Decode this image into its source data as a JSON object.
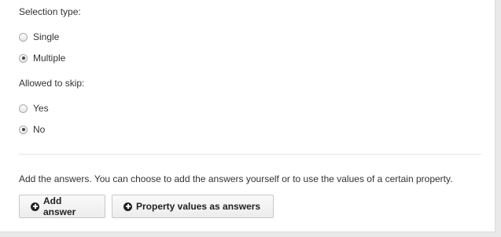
{
  "selection_type": {
    "label": "Selection type:",
    "options": [
      {
        "label": "Single",
        "checked": false
      },
      {
        "label": "Multiple",
        "checked": true
      }
    ]
  },
  "allowed_to_skip": {
    "label": "Allowed to skip:",
    "options": [
      {
        "label": "Yes",
        "checked": false
      },
      {
        "label": "No",
        "checked": true
      }
    ]
  },
  "answers": {
    "description": "Add the answers. You can choose to add the answers yourself or to use the values of a certain property.",
    "add_answer_label": "Add answer",
    "property_values_label": "Property values as answers"
  }
}
